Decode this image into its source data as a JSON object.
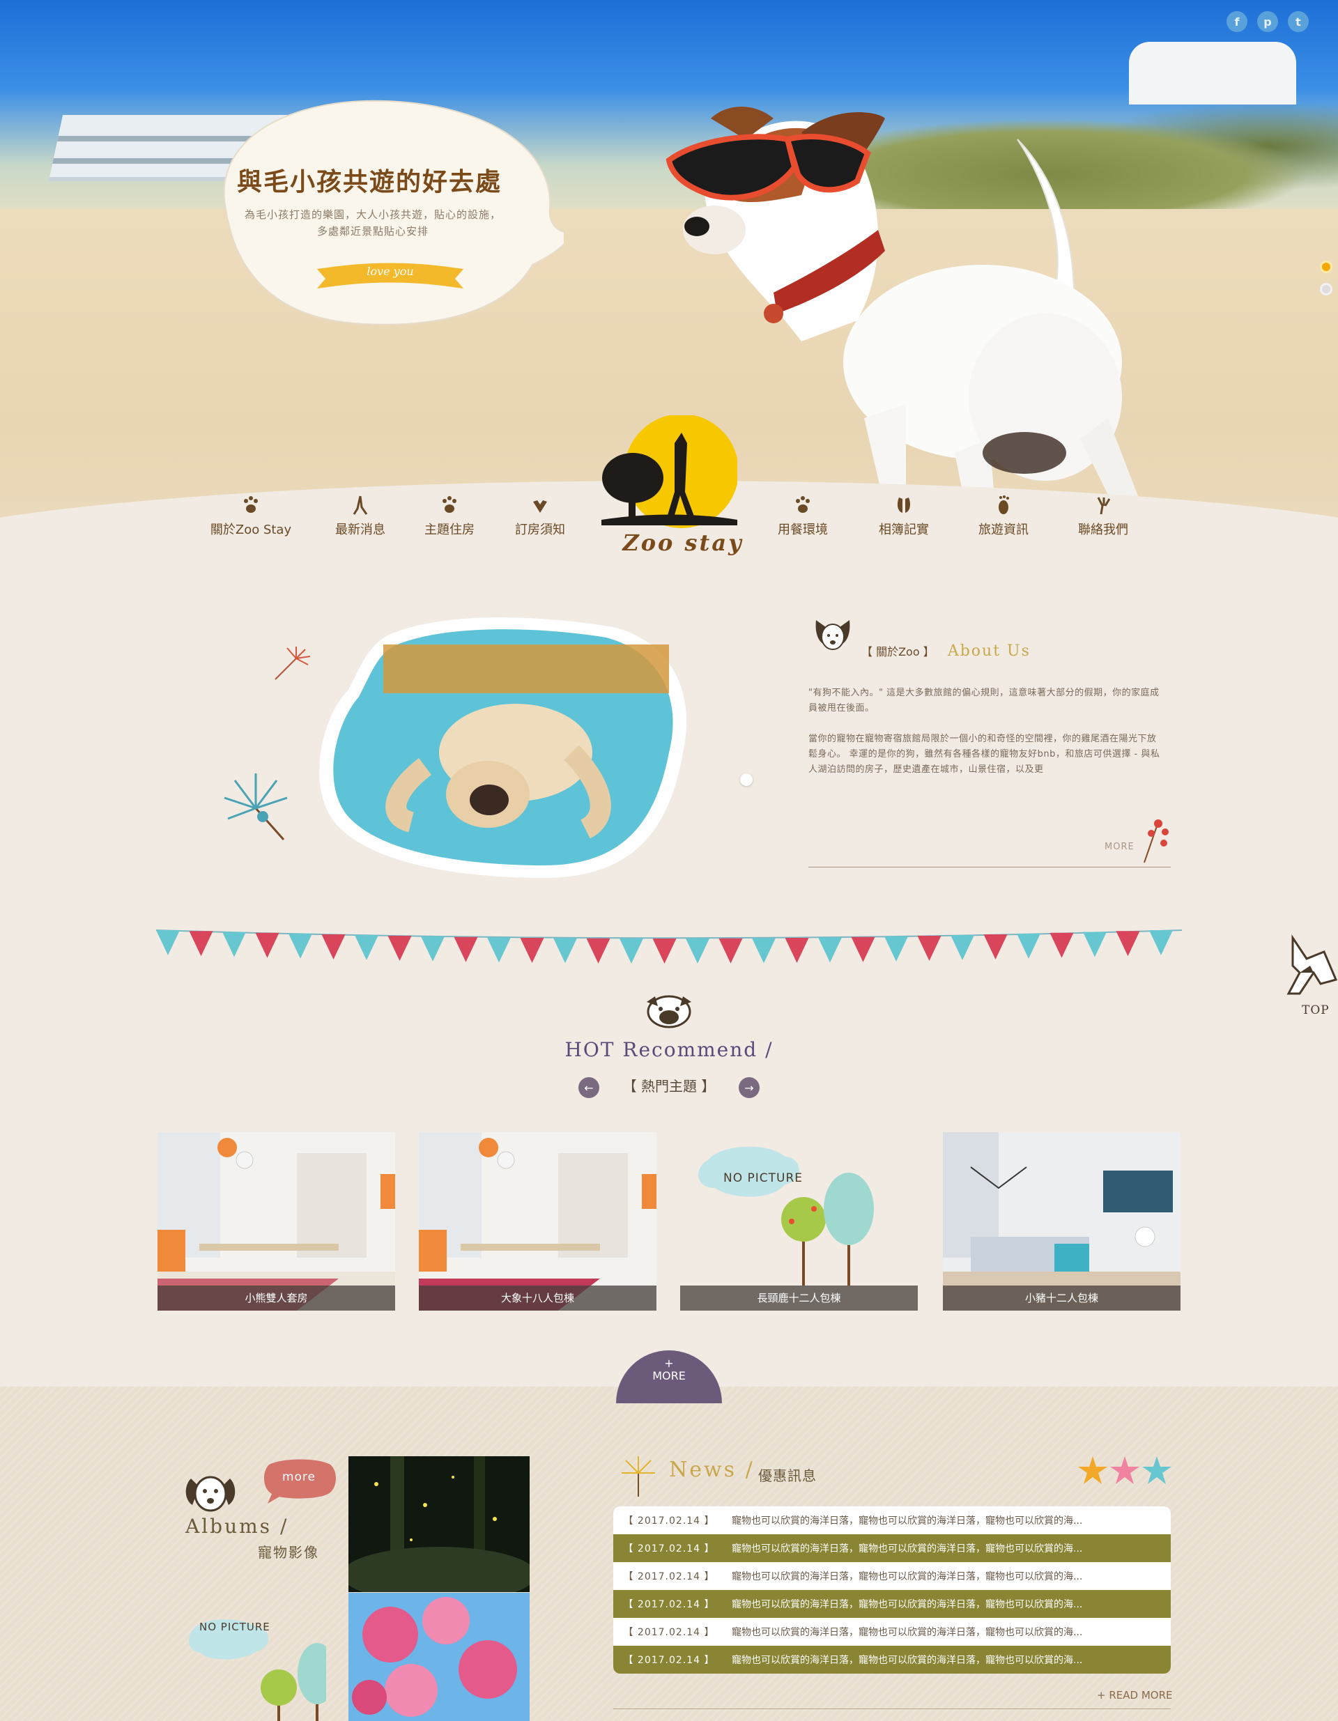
{
  "social": [
    "f",
    "p",
    "t"
  ],
  "hero": {
    "title": "與毛小孩共遊的好去處",
    "text": "為毛小孩打造的樂園，大人小孩共遊，貼心的設施，多處鄰近景點貼心安排",
    "ribbon": "love you"
  },
  "logo": {
    "text": "Zoo stay"
  },
  "nav": [
    {
      "label": "關於Zoo Stay",
      "icon": "paw-icon"
    },
    {
      "label": "最新消息",
      "icon": "footprint-icon"
    },
    {
      "label": "主題住房",
      "icon": "paw-icon"
    },
    {
      "label": "訂房須知",
      "icon": "hoof-icon"
    },
    {
      "label": "用餐環境",
      "icon": "paw-icon"
    },
    {
      "label": "相簿記實",
      "icon": "hoof-icon"
    },
    {
      "label": "旅遊資訊",
      "icon": "footprint-icon"
    },
    {
      "label": "聯絡我們",
      "icon": "claw-icon"
    }
  ],
  "about": {
    "title_zh": "【 關於Zoo 】",
    "title_en": "About Us",
    "p1": "\"有狗不能入內。\" 這是大多數旅館的偏心規則，這意味著大部分的假期，你的家庭成員被甩在後面。",
    "p2": "當你的寵物在寵物寄宿旅館局限於一個小的和奇怪的空間裡，你的雞尾酒在陽光下放鬆身心。 幸運的是你的狗，雖然有各種各樣的寵物友好bnb，和旅店可供選擇 - 與私人湖泊訪問的房子，歷史遺產在城市，山景住宿，以及更",
    "more": "MORE"
  },
  "top": "TOP",
  "hot": {
    "title": "HOT Recommend /",
    "sub": "【 熱門主題 】",
    "prev": "←",
    "next": "→",
    "no_picture": "NO PICTURE",
    "cards": [
      {
        "caption": "小熊雙人套房"
      },
      {
        "caption": "大象十八人包棟"
      },
      {
        "caption": "長頸鹿十二人包棟"
      },
      {
        "caption": "小豬十二人包棟"
      }
    ],
    "more_plus": "+",
    "more": "MORE"
  },
  "albums": {
    "bubble": "more",
    "title": "Albums /",
    "sub": "寵物影像",
    "no_picture": "NO PICTURE"
  },
  "news": {
    "title": "News /",
    "sub": "優惠訊息",
    "rows": [
      {
        "date": "【 2017.02.14 】",
        "text": "寵物也可以欣賞的海洋日落，寵物也可以欣賞的海洋日落，寵物也可以欣賞的海..."
      },
      {
        "date": "【 2017.02.14 】",
        "text": "寵物也可以欣賞的海洋日落，寵物也可以欣賞的海洋日落，寵物也可以欣賞的海..."
      },
      {
        "date": "【 2017.02.14 】",
        "text": "寵物也可以欣賞的海洋日落，寵物也可以欣賞的海洋日落，寵物也可以欣賞的海..."
      },
      {
        "date": "【 2017.02.14 】",
        "text": "寵物也可以欣賞的海洋日落，寵物也可以欣賞的海洋日落，寵物也可以欣賞的海..."
      },
      {
        "date": "【 2017.02.14 】",
        "text": "寵物也可以欣賞的海洋日落，寵物也可以欣賞的海洋日落，寵物也可以欣賞的海..."
      },
      {
        "date": "【 2017.02.14 】",
        "text": "寵物也可以欣賞的海洋日落，寵物也可以欣賞的海洋日落，寵物也可以欣賞的海..."
      }
    ],
    "read_more": "+ READ MORE"
  }
}
